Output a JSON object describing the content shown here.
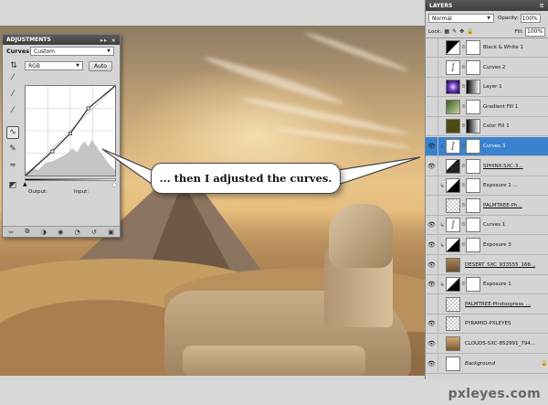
{
  "callout": {
    "text": "... then I adjusted the curves."
  },
  "adjustments": {
    "tab": "ADJUSTMENTS",
    "controls": "▸▸ ×",
    "title": "Curves",
    "preset": "Custom",
    "channel": "RGB",
    "auto_label": "Auto",
    "output_label": "Output:",
    "input_label": "Input:",
    "curve_points": [
      [
        0,
        0
      ],
      [
        0.3,
        0.27
      ],
      [
        0.5,
        0.47
      ],
      [
        0.7,
        0.75
      ],
      [
        1,
        1
      ]
    ]
  },
  "layers": {
    "tab": "LAYERS",
    "blend_mode": "Normal",
    "opacity_label": "Opacity:",
    "opacity_value": "100%",
    "lock_label": "Lock:",
    "fill_label": "Fill:",
    "fill_value": "100%",
    "items": [
      {
        "name": "Black & White 1",
        "visible": false,
        "thumb": "bw-adjust",
        "mask": true
      },
      {
        "name": "Curves 2",
        "visible": false,
        "thumb": "curves-adjust",
        "mask": true
      },
      {
        "name": "Layer 1",
        "visible": false,
        "thumb": "purple-glow",
        "mask": true,
        "mask_gradient": true
      },
      {
        "name": "Gradient Fill 1",
        "visible": false,
        "thumb": "gradient",
        "mask": true
      },
      {
        "name": "Color Fill 1",
        "visible": false,
        "thumb": "olive",
        "mask": true,
        "mask_gradient": true
      },
      {
        "name": "Curves 3",
        "visible": true,
        "selected": true,
        "thumb": "curves-adjust",
        "mask": true,
        "clipped": true
      },
      {
        "name": "SPHINX-SXC-3...",
        "visible": true,
        "thumb": "sphinx",
        "mask": true,
        "underline": true
      },
      {
        "name": "Exposure 1 ...",
        "visible": false,
        "thumb": "exposure",
        "mask": true,
        "clipped": true
      },
      {
        "name": "PALMTREE-Ph...",
        "visible": false,
        "thumb": "transparent",
        "mask": true,
        "underline": true
      },
      {
        "name": "Curves 1",
        "visible": true,
        "thumb": "curves-adjust",
        "mask": true,
        "clipped": true
      },
      {
        "name": "Exposure 3",
        "visible": true,
        "thumb": "exposure",
        "mask": true,
        "clipped": true
      },
      {
        "name": "DESERT_SXC_933555_166...",
        "visible": true,
        "thumb": "desert",
        "mask": false,
        "underline": true
      },
      {
        "name": "Exposure 1",
        "visible": true,
        "thumb": "exposure",
        "mask": true,
        "clipped": true
      },
      {
        "name": "PALMTREE-Photoxpress_...",
        "visible": false,
        "thumb": "transparent",
        "mask": false,
        "underline": true
      },
      {
        "name": "PYRAMID-PXLEYES",
        "visible": true,
        "thumb": "transparent",
        "mask": false
      },
      {
        "name": "CLOUDS-SXC-852991_794...",
        "visible": true,
        "thumb": "clouds",
        "mask": false
      },
      {
        "name": "Background",
        "visible": true,
        "thumb": "white",
        "mask": false,
        "italic": true,
        "locked": true
      }
    ]
  },
  "watermark": "pxleyes.com",
  "colors": {
    "selection": "#3a82cf",
    "panel": "#d4d4d4",
    "tab": "#4a4a4a"
  }
}
